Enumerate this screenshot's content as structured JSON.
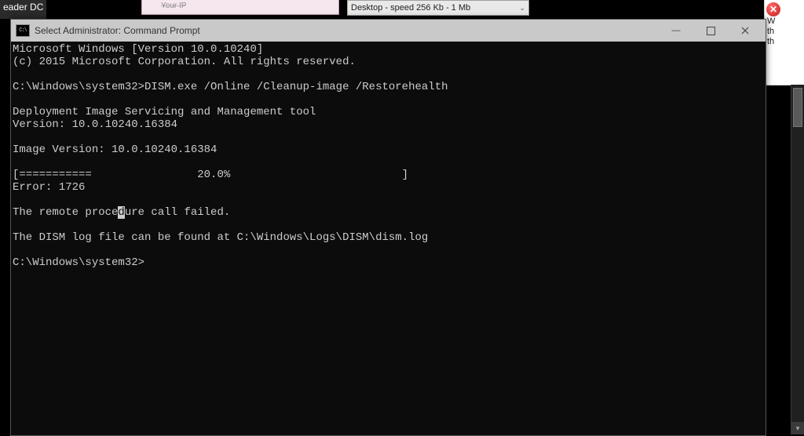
{
  "taskbar": {
    "app_fragment": "eader DC"
  },
  "background": {
    "field_label": "Your IP",
    "dropdown_value": "Desktop - speed  256 Kb - 1 Mb"
  },
  "right_popup": {
    "icon_glyph": "✕",
    "line1": "W",
    "line2": "th",
    "line3": "th"
  },
  "window": {
    "title": "Select Administrator: Command Prompt",
    "icon_text": "C:\\"
  },
  "console": {
    "line1": "Microsoft Windows [Version 10.0.10240]",
    "line2": "(c) 2015 Microsoft Corporation. All rights reserved.",
    "blank1": "",
    "prompt1": "C:\\Windows\\system32>DISM.exe /Online /Cleanup-image /Restorehealth",
    "blank2": "",
    "tool1": "Deployment Image Servicing and Management tool",
    "tool2": "Version: 10.0.10240.16384",
    "blank3": "",
    "imgver": "Image Version: 10.0.10240.16384",
    "blank4": "",
    "progress": "[===========                20.0%                          ]",
    "error": "Error: 1726",
    "blank5": "",
    "err_pre": "The remote proce",
    "err_cursor": "d",
    "err_post": "ure call failed.",
    "blank6": "",
    "logline": "The DISM log file can be found at C:\\Windows\\Logs\\DISM\\dism.log",
    "blank7": "",
    "prompt2": "C:\\Windows\\system32>"
  },
  "glyphs": {
    "minimize": "—",
    "chevron_down": "⌄",
    "scroll_down": "▾"
  }
}
